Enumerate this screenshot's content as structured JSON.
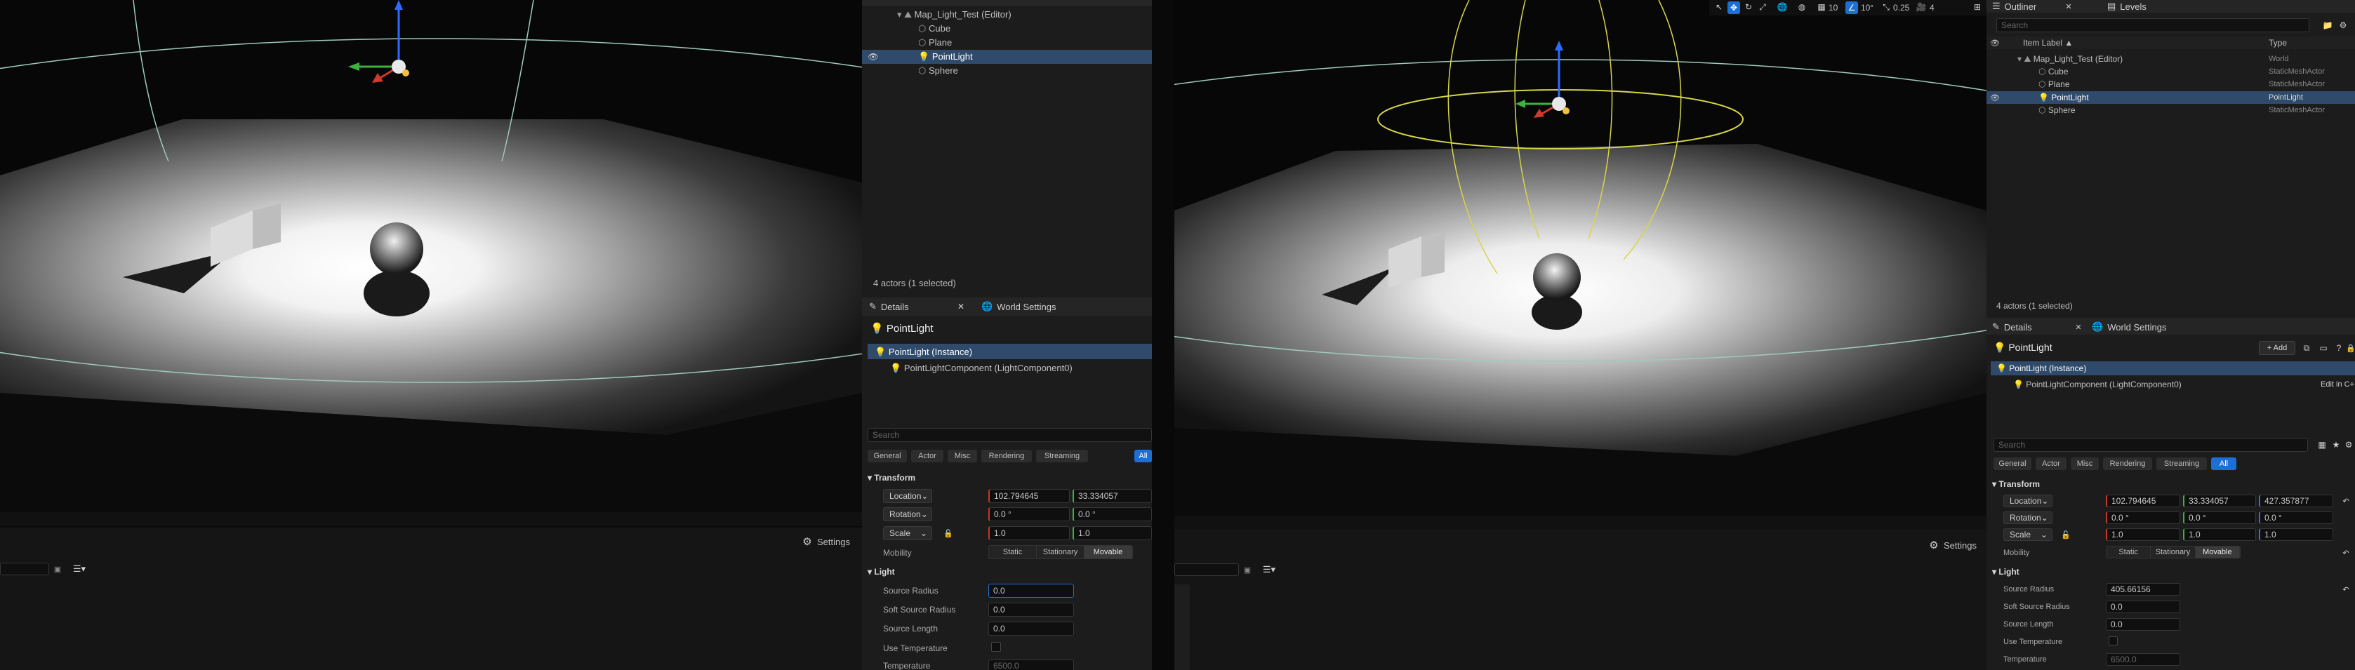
{
  "outliner": {
    "items": [
      {
        "label": "Map_Light_Test (Editor)",
        "type": "World"
      },
      {
        "label": "Cube",
        "type": "StaticMeshActor"
      },
      {
        "label": "Plane",
        "type": "StaticMeshActor"
      },
      {
        "label": "PointLight",
        "type": "PointLight"
      },
      {
        "label": "Sphere",
        "type": "StaticMeshActor"
      }
    ],
    "status": "4 actors (1 selected)",
    "header_label": "Item Label ▲",
    "header_type": "Type",
    "search_placeholder": "Search"
  },
  "tabs": {
    "outliner": "Outliner",
    "levels": "Levels",
    "details": "Details",
    "world_settings": "World Settings"
  },
  "details": {
    "actor_name": "PointLight",
    "add_label": "+ Add",
    "instance_label": "PointLight (Instance)",
    "component_label": "PointLightComponent (LightComponent0)",
    "edit_in_cpp": "Edit in C++",
    "search_placeholder": "Search",
    "filters": [
      "General",
      "Actor",
      "Misc",
      "Rendering",
      "Streaming",
      "All"
    ],
    "active_filter": "All",
    "transform_header": "Transform",
    "location_label": "Location",
    "rotation_label": "Rotation",
    "scale_label": "Scale",
    "location_values": [
      "102.794645",
      "33.334057",
      "427.357877"
    ],
    "rotation_values": [
      "0.0 °",
      "0.0 °",
      "0.0 °"
    ],
    "scale_values": [
      "1.0",
      "1.0",
      "1.0"
    ],
    "mobility_label": "Mobility",
    "mobility_options": [
      "Static",
      "Stationary",
      "Movable"
    ],
    "mobility_selected": "Movable",
    "light_header": "Light",
    "source_radius_label": "Source Radius",
    "soft_source_radius_label": "Soft Source Radius",
    "source_length_label": "Source Length",
    "use_temperature_label": "Use Temperature",
    "temperature_label": "Temperature",
    "left_source_radius": "0.0",
    "right_source_radius": "405.66156",
    "soft_source_radius": "0.0",
    "source_length": "0.0",
    "temperature": "6500.0"
  },
  "bottom_bar": {
    "settings_label": "Settings"
  },
  "viewport_toolbar": {
    "grid_snap": "10",
    "rot_snap": "10°",
    "scale_snap": "0.25",
    "camera_speed": "4"
  }
}
